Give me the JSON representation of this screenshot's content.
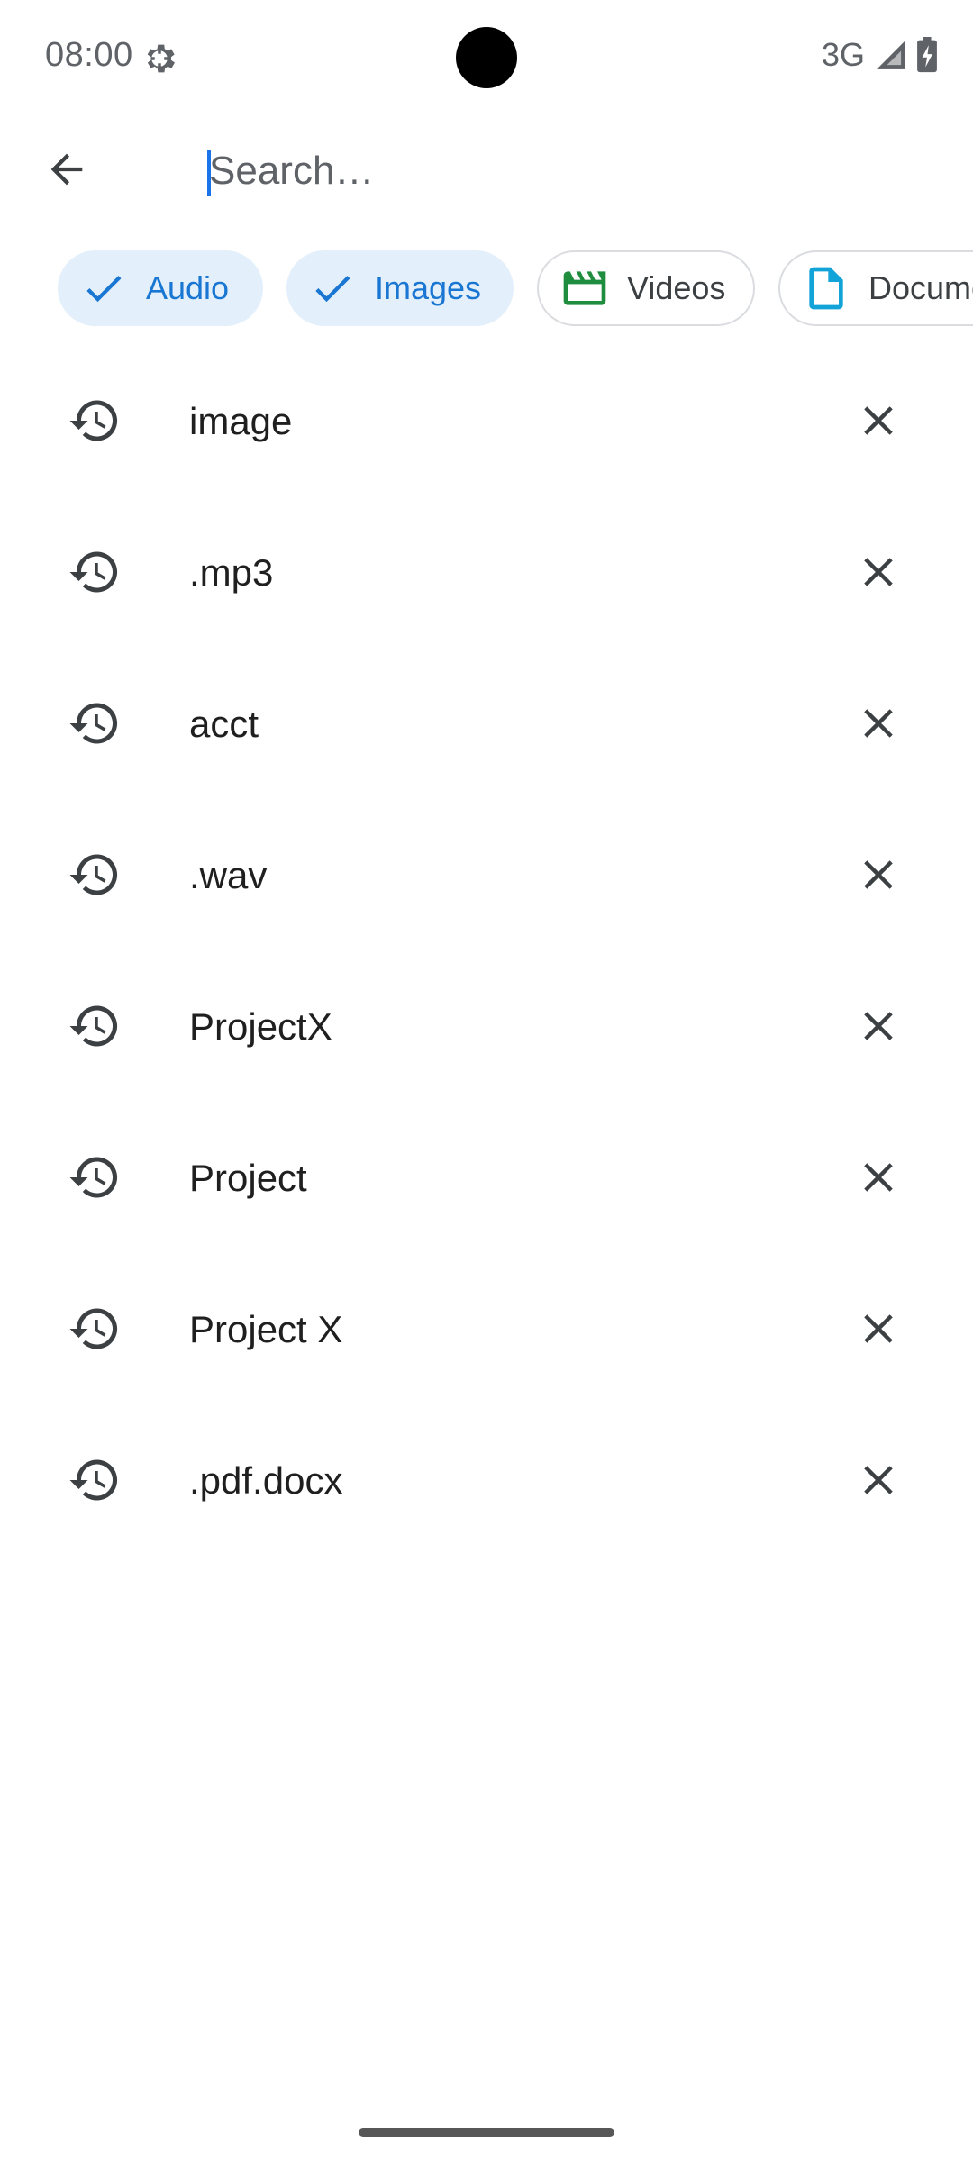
{
  "status_bar": {
    "time": "08:00",
    "network": "3G",
    "icons": [
      "gear-icon",
      "cell-signal-icon",
      "battery-charging-icon"
    ]
  },
  "search": {
    "placeholder": "Search…",
    "value": "",
    "back_icon": "arrow-back-icon"
  },
  "chips": [
    {
      "label": "Audio",
      "selected": true,
      "icon": "check-icon"
    },
    {
      "label": "Images",
      "selected": true,
      "icon": "check-icon"
    },
    {
      "label": "Videos",
      "selected": false,
      "icon": "clapperboard-icon"
    },
    {
      "label": "Documents",
      "selected": false,
      "icon": "document-icon"
    }
  ],
  "recent_searches": [
    {
      "text": "image"
    },
    {
      "text": ".mp3"
    },
    {
      "text": "acct"
    },
    {
      "text": ".wav"
    },
    {
      "text": "ProjectX"
    },
    {
      "text": "Project"
    },
    {
      "text": "Project X"
    },
    {
      "text": ".pdf.docx"
    }
  ],
  "colors": {
    "accent": "#1976d2",
    "chip_selected_bg": "#e3f0fb",
    "video_icon": "#1e8e3e",
    "doc_icon": "#12a4d9",
    "icon_gray": "#3c4043"
  }
}
